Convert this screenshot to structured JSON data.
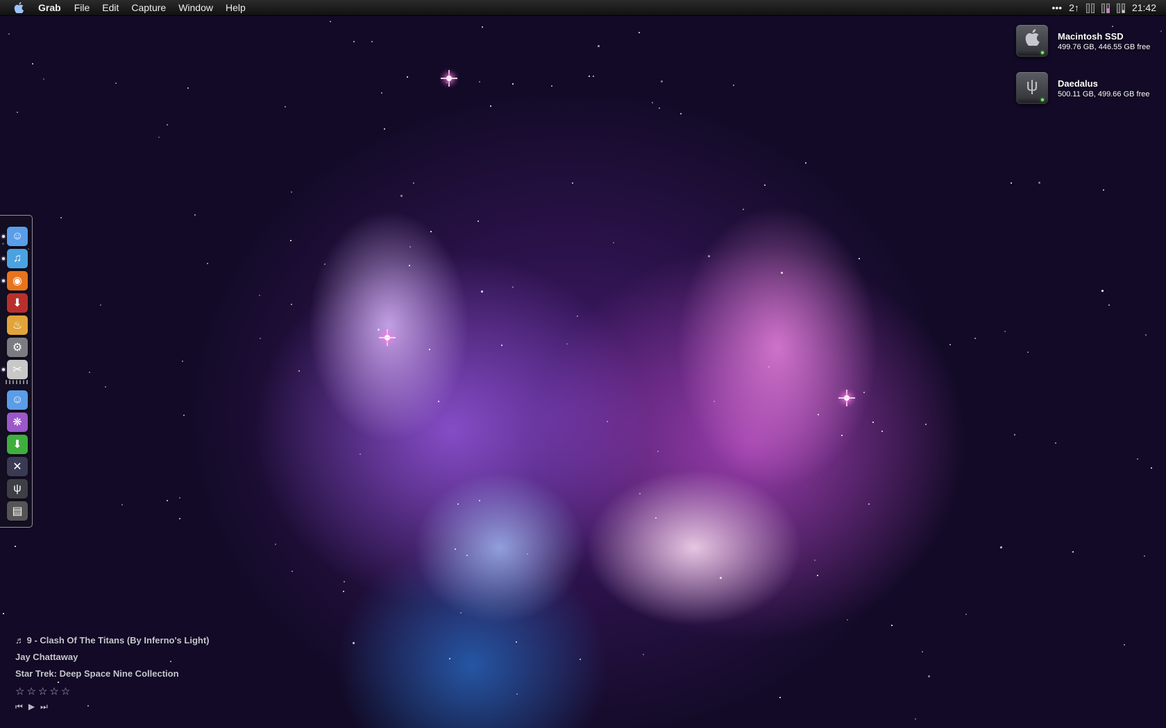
{
  "menubar": {
    "app_name": "Grab",
    "items": [
      "File",
      "Edit",
      "Capture",
      "Window",
      "Help"
    ],
    "status": {
      "more": "•••",
      "network": "2↑",
      "clock": "21:42"
    }
  },
  "drives": [
    {
      "name": "Macintosh SSD",
      "info": "499.76 GB, 446.55 GB free",
      "icon": "apple-logo-icon"
    },
    {
      "name": "Daedalus",
      "info": "500.11 GB, 499.66 GB free",
      "icon": "usb-icon"
    }
  ],
  "dock": {
    "apps": [
      {
        "icon": "finder-icon",
        "running": true,
        "color": "#5a9de8",
        "glyph": "☺"
      },
      {
        "icon": "itunes-icon",
        "running": true,
        "color": "#4aa3e0",
        "glyph": "♫"
      },
      {
        "icon": "firefox-icon",
        "running": true,
        "color": "#e8731e",
        "glyph": "◉"
      },
      {
        "icon": "download-utility-icon",
        "running": false,
        "color": "#b8302e",
        "glyph": "⬇"
      },
      {
        "icon": "flame-app-icon",
        "running": false,
        "color": "#e0a43a",
        "glyph": "♨"
      },
      {
        "icon": "system-preferences-icon",
        "running": false,
        "color": "#7a7c82",
        "glyph": "⚙"
      },
      {
        "icon": "grab-icon",
        "running": true,
        "color": "#c8c8c8",
        "glyph": "✂"
      }
    ],
    "stacks": [
      {
        "icon": "finder-stack-icon",
        "color": "#5a9de8",
        "glyph": "☺"
      },
      {
        "icon": "desktop-picture-icon",
        "color": "#9a58c8",
        "glyph": "❋"
      },
      {
        "icon": "downloads-icon",
        "color": "#3fae3f",
        "glyph": "⬇"
      },
      {
        "icon": "x11-icon",
        "color": "#3a3a55",
        "glyph": "✕"
      },
      {
        "icon": "usb-drive-icon",
        "color": "#3d3f45",
        "glyph": "ψ"
      },
      {
        "icon": "trash-icon",
        "color": "#555",
        "glyph": "▤"
      }
    ]
  },
  "now_playing": {
    "track": "♬ 9 - Clash Of The Titans (By Inferno's Light)",
    "artist": "Jay Chattaway",
    "album": "Star Trek: Deep Space Nine Collection",
    "rating": "☆☆☆☆☆",
    "controls": [
      "⏮",
      "▶",
      "⏭"
    ]
  }
}
